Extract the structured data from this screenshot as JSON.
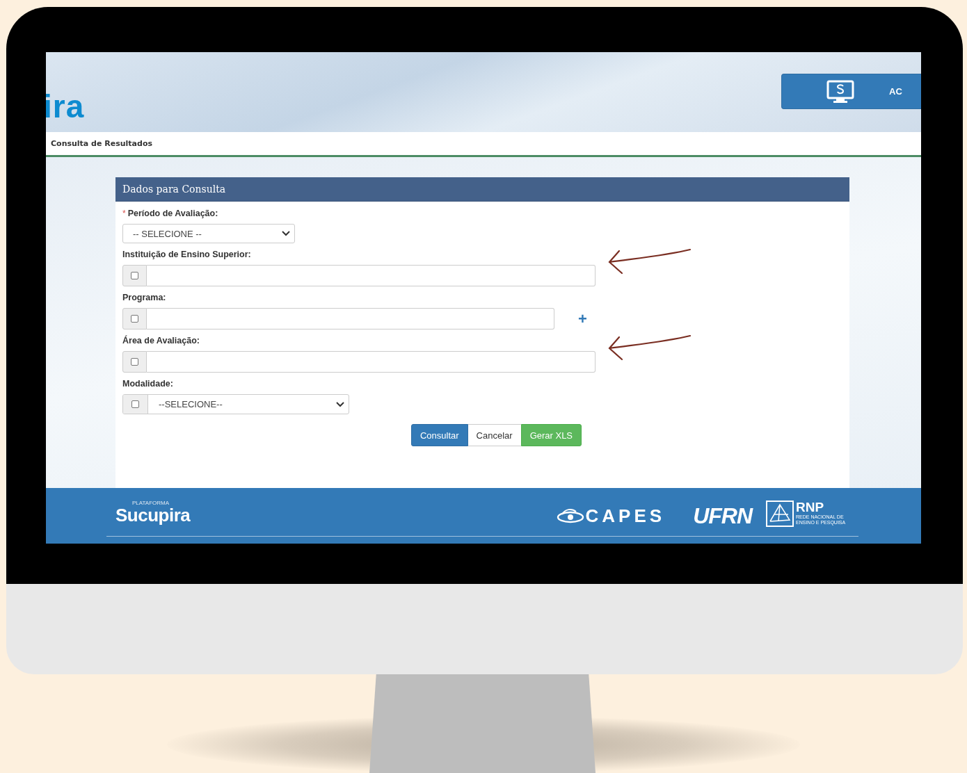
{
  "header": {
    "logo_text": "ira",
    "access_button": "AC"
  },
  "breadcrumb": "Consulta de Resultados",
  "form": {
    "title": "Dados para Consulta",
    "fields": [
      {
        "kind": "select",
        "label": "Período de Avaliação:",
        "required_mark": "*",
        "value": "-- SELECIONE --"
      },
      {
        "kind": "text",
        "label": "Instituição de Ensino Superior:",
        "checked": false,
        "annotated": true
      },
      {
        "kind": "text",
        "label": "Programa:",
        "checked": false,
        "add_button": "+",
        "annotated": false
      },
      {
        "kind": "text",
        "label": "Área de Avaliação:",
        "checked": false,
        "annotated": true
      },
      {
        "kind": "checkselect",
        "label": "Modalidade:",
        "checked": false,
        "value": "--SELECIONE--"
      }
    ],
    "buttons": [
      {
        "kind": "primary",
        "label": "Consultar"
      },
      {
        "kind": "default",
        "label": "Cancelar"
      },
      {
        "kind": "success",
        "label": "Gerar XLS"
      }
    ]
  },
  "footer": {
    "sucupira_small": "PLATAFORMA",
    "sucupira": "Sucupira",
    "capes": "CAPES",
    "ufrn": "UFRN",
    "rnp": "RNP",
    "rnp_sub": "REDE NACIONAL DE ENSINO E PESQUISA"
  }
}
